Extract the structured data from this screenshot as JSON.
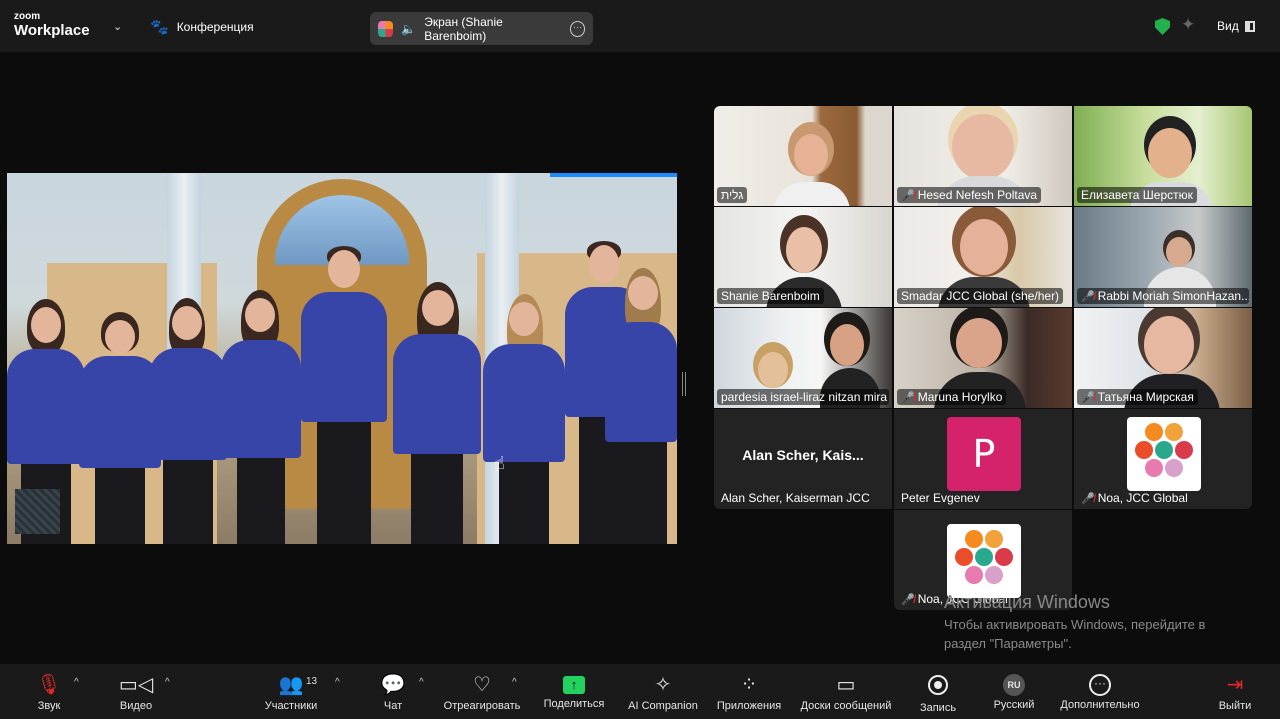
{
  "topbar": {
    "brand_top": "zoom",
    "brand_bottom": "Workplace",
    "meeting_label": "Конференция",
    "screen_share_label": "Экран (Shanie Barenboim)",
    "view_label": "Вид"
  },
  "participants": [
    {
      "name": "גלית",
      "muted": false
    },
    {
      "name": "Hesed Nefesh Poltava",
      "muted": true
    },
    {
      "name": "Елизавета Шерстюк",
      "muted": false
    },
    {
      "name": "Shanie Barenboim",
      "muted": false
    },
    {
      "name": "Smadar JCC Global (she/her)",
      "muted": false
    },
    {
      "name": "Rabbi Moriah SimonHazan...",
      "muted": true
    },
    {
      "name": "pardesia israel-liraz nitzan mira",
      "muted": false,
      "active": true
    },
    {
      "name": "Maruna Horylko",
      "muted": true
    },
    {
      "name": "Татьяна Мирская",
      "muted": true
    },
    {
      "name": "Alan Scher, Kaiserman JCC",
      "big_label": "Alan Scher,  Kais...",
      "muted": false
    },
    {
      "name": "Peter Evgenev",
      "avatar_letter": "P",
      "muted": false
    },
    {
      "name": "Noa, JCC Global",
      "muted": true
    },
    {
      "name": "Noa, JCC Global",
      "muted": true
    }
  ],
  "watermark": {
    "title": "Активация Windows",
    "text": "Чтобы активировать Windows, перейдите в раздел \"Параметры\"."
  },
  "toolbar": {
    "audio": "Звук",
    "video": "Видео",
    "participants": "Участники",
    "participants_count": "13",
    "chat": "Чат",
    "react": "Отреагировать",
    "share": "Поделиться",
    "ai": "AI Companion",
    "apps": "Приложения",
    "whiteboards": "Доски сообщений",
    "record": "Запись",
    "language": "Русский",
    "language_code": "RU",
    "more": "Дополнительно",
    "leave": "Выйти"
  },
  "colors": {
    "accent_green": "#23d160",
    "muted_red": "#e02828",
    "avatar_pink": "#d4236b"
  }
}
